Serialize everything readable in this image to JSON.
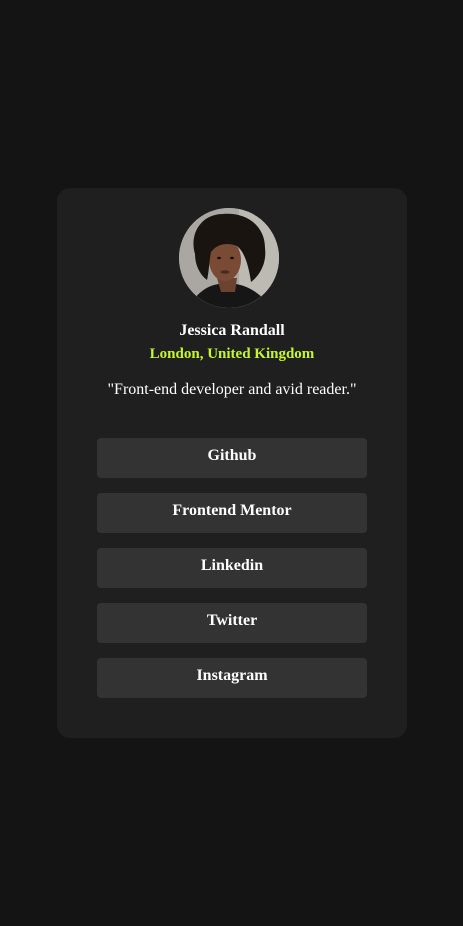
{
  "profile": {
    "name": "Jessica Randall",
    "location": "London, United Kingdom",
    "bio": "\"Front-end developer and avid reader.\""
  },
  "links": [
    {
      "label": "Github"
    },
    {
      "label": "Frontend Mentor"
    },
    {
      "label": "Linkedin"
    },
    {
      "label": "Twitter"
    },
    {
      "label": "Instagram"
    }
  ],
  "colors": {
    "background": "#141414",
    "card": "#1f1f1f",
    "button": "#333333",
    "accent": "#c4f82a",
    "text": "#ffffff"
  }
}
